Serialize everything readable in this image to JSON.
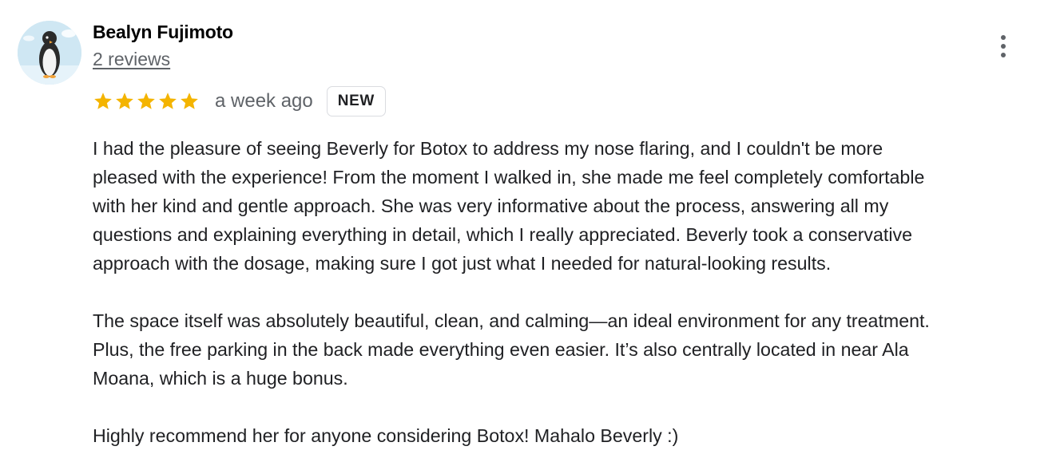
{
  "review": {
    "reviewer_name": "Bealyn Fujimoto",
    "review_count": "2 reviews",
    "rating": 5,
    "rating_max": 5,
    "date": "a week ago",
    "badge": "NEW",
    "star_color": "#f4b400",
    "avatar_icon": "penguin-avatar-icon",
    "menu_icon": "more-vert-icon",
    "paragraphs": [
      "I had the pleasure of seeing Beverly for Botox to address my nose flaring, and I couldn't be more\npleased with the experience! From the moment I walked in, she made me feel completely comfortable\nwith her kind and gentle approach. She was very informative about the process, answering all my\nquestions and explaining everything in detail, which I really appreciated. Beverly took a conservative\napproach with the dosage, making sure I got just what I needed for natural-looking results.",
      "The space itself was absolutely beautiful, clean, and calming—an ideal environment for any treatment.\nPlus, the free parking in the back made everything even easier. It’s also centrally located in near Ala\nMoana, which is a huge bonus.",
      "Highly recommend her for anyone considering Botox! Mahalo Beverly :)"
    ]
  }
}
